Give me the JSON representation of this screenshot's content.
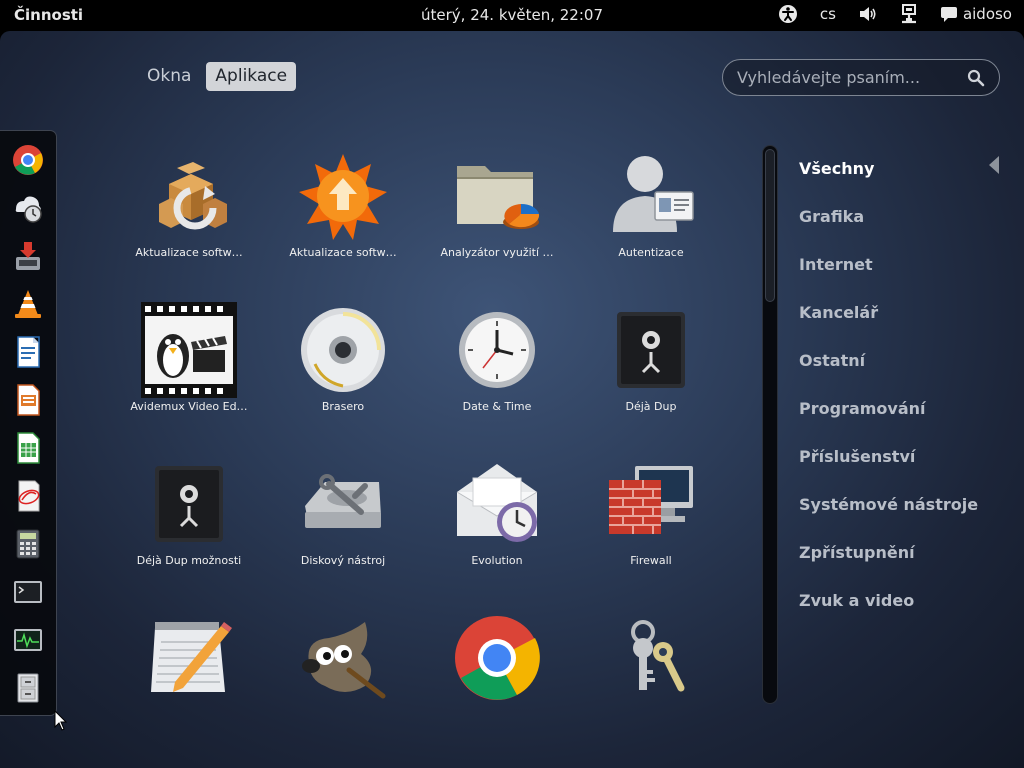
{
  "topbar": {
    "activities": "Činnosti",
    "clock": "úterý, 24. květen, 22:07",
    "keyboard_layout": "cs",
    "user": "aidoso"
  },
  "views": {
    "windows": "Okna",
    "applications": "Aplikace"
  },
  "search": {
    "placeholder": "Vyhledávejte psaním..."
  },
  "dash": {
    "items": [
      "chrome-icon",
      "backup-clock-icon",
      "installer-icon",
      "vlc-icon",
      "writer-icon",
      "impress-icon",
      "calc-icon",
      "evolution-mail-icon",
      "calculator-icon",
      "terminal-icon",
      "system-monitor-icon",
      "file-cabinet-icon"
    ]
  },
  "apps": [
    {
      "label": "Aktualizace softw…",
      "icon": "package-update-icon"
    },
    {
      "label": "Aktualizace softw…",
      "icon": "update-star-icon"
    },
    {
      "label": "Analyzátor využití …",
      "icon": "disk-usage-analyzer-icon"
    },
    {
      "label": "Autentizace",
      "icon": "authentication-icon"
    },
    {
      "label": "Avidemux Video Ed…",
      "icon": "avidemux-icon"
    },
    {
      "label": "Brasero",
      "icon": "brasero-disc-icon"
    },
    {
      "label": "Date & Time",
      "icon": "clock-icon"
    },
    {
      "label": "Déjà Dup",
      "icon": "deja-dup-safe-icon"
    },
    {
      "label": "Déjà Dup možnosti",
      "icon": "deja-dup-options-icon"
    },
    {
      "label": "Diskový nástroj",
      "icon": "disk-utility-icon"
    },
    {
      "label": "Evolution",
      "icon": "evolution-icon"
    },
    {
      "label": "Firewall",
      "icon": "firewall-icon"
    },
    {
      "label": "",
      "icon": "text-editor-icon"
    },
    {
      "label": "",
      "icon": "gimp-icon"
    },
    {
      "label": "",
      "icon": "chrome-icon"
    },
    {
      "label": "",
      "icon": "keys-icon"
    }
  ],
  "categories": [
    "Všechny",
    "Grafika",
    "Internet",
    "Kancelář",
    "Ostatní",
    "Programování",
    "Příslušenství",
    "Systémové nástroje",
    "Zpřístupnění",
    "Zvuk a video"
  ]
}
